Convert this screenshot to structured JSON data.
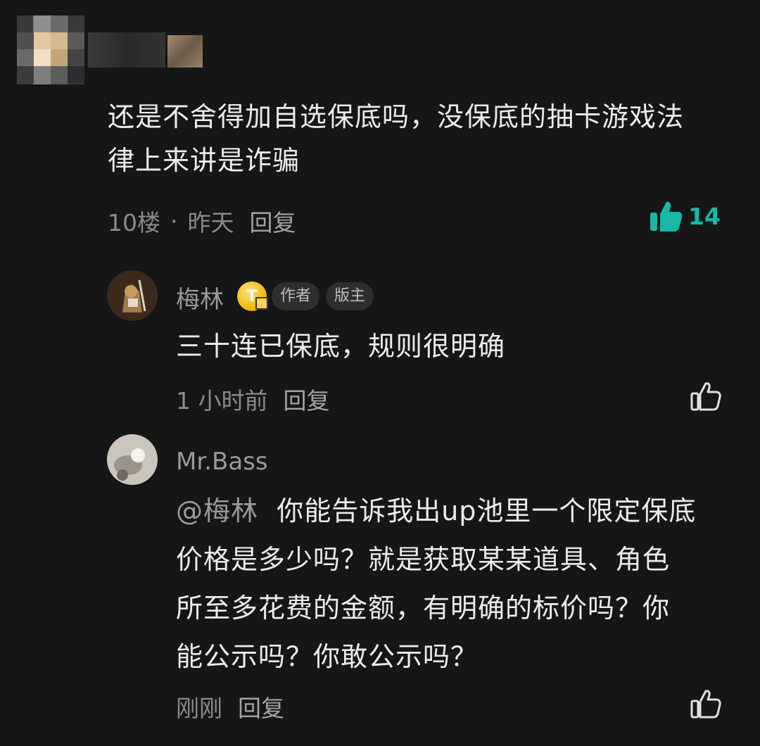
{
  "main_comment": {
    "text_line1": "还是不舍得加自选保底吗，没保底的抽卡游戏法",
    "text_line2": "律上来讲是诈骗",
    "floor": "10楼",
    "separator": "·",
    "time": "昨天",
    "reply_label": "回复",
    "like_count": "14"
  },
  "replies": [
    {
      "username": "梅林",
      "level_badge": "T",
      "tags": [
        "作者",
        "版主"
      ],
      "text": "三十连已保底，规则很明确",
      "time": "1 小时前",
      "reply_label": "回复"
    },
    {
      "username": "Mr.Bass",
      "mention": "@梅林",
      "text_line1": "你能告诉我出up池里一个限定保底",
      "text_line2": "价格是多少吗？就是获取某某道具、角色",
      "text_line3": "所至多花费的金额，有明确的标价吗？你",
      "text_line4": "能公示吗？你敢公示吗？",
      "time": "刚刚",
      "reply_label": "回复"
    }
  ],
  "colors": {
    "background": "#161616",
    "accent_like": "#17b8a6",
    "meta_text": "#8a8a8a",
    "body_text": "#ececec"
  },
  "icons": {
    "liked": "thumbs-up-filled-icon",
    "like": "thumbs-up-outline-icon"
  }
}
